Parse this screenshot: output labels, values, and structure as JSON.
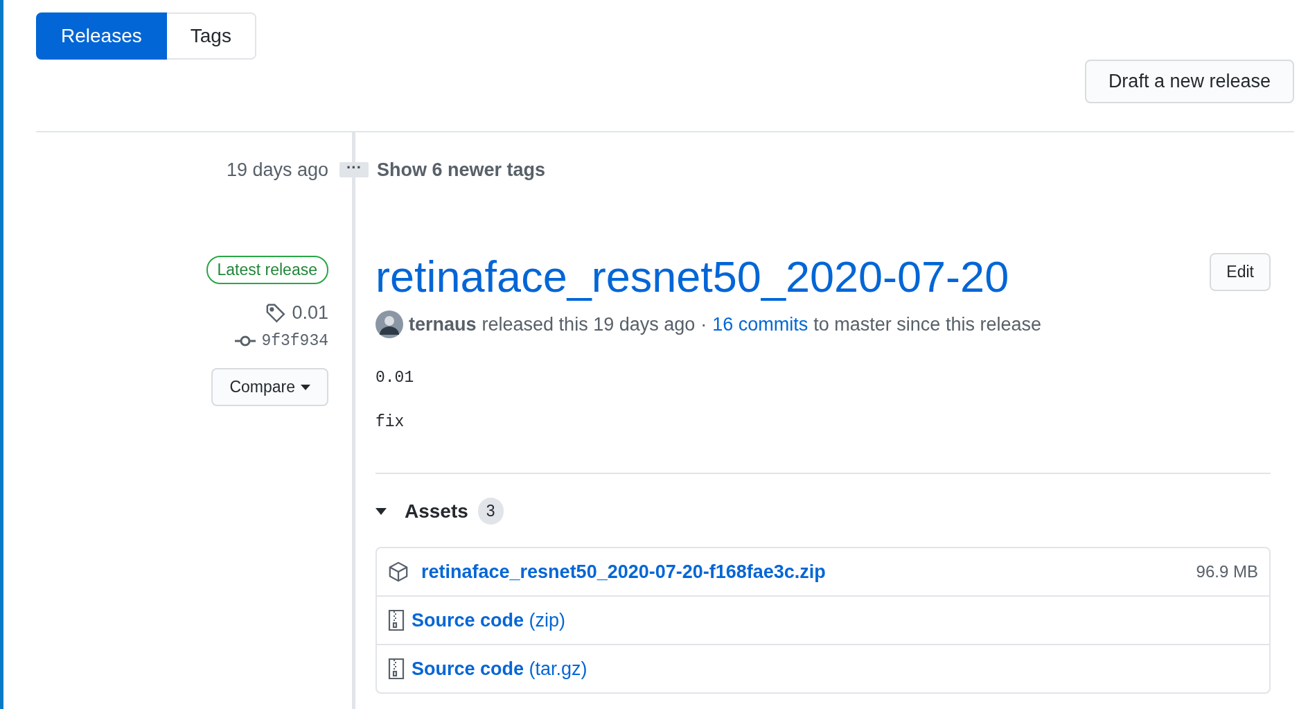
{
  "tabs": [
    {
      "label": "Releases",
      "selected": true
    },
    {
      "label": "Tags",
      "selected": false
    }
  ],
  "draft_button": "Draft a new release",
  "newer_tags": {
    "time": "19 days ago",
    "ellipsis": "···",
    "label": "Show 6 newer tags"
  },
  "release": {
    "badge": "Latest release",
    "tag": "0.01",
    "commit": "9f3f934",
    "compare": "Compare",
    "title": "retinaface_resnet50_2020-07-20",
    "edit": "Edit",
    "author": "ternaus",
    "released": "released this 19 days ago",
    "separator": "·",
    "commits_link": "16 commits",
    "commits_text": "to master since this release",
    "notes": [
      "0.01",
      "fix"
    ]
  },
  "assets": {
    "label": "Assets",
    "count": "3",
    "expanded": true,
    "items": [
      {
        "kind": "package",
        "name": "retinaface_resnet50_2020-07-20-f168fae3c.zip",
        "size": "96.9 MB"
      },
      {
        "kind": "source",
        "name": "**Source code** (zip)"
      },
      {
        "kind": "source",
        "name": "**Source code** (tar.gz)"
      }
    ]
  }
}
